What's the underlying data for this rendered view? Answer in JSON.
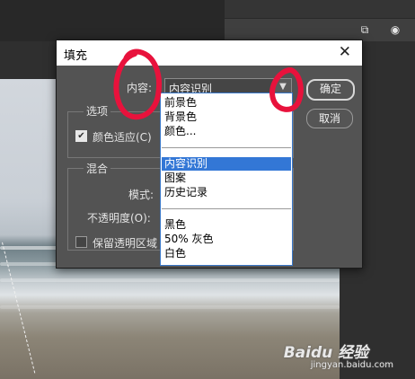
{
  "dialog": {
    "title": "填充",
    "content_label": "内容:",
    "content_value": "内容识别",
    "ok_label": "确定",
    "cancel_label": "取消",
    "options_group": "选项",
    "color_adapt_label": "颜色适应(C)",
    "blend_group": "混合",
    "mode_label": "模式:",
    "opacity_label": "不透明度(O):",
    "preserve_label": "保留透明区域"
  },
  "dropdown": {
    "group1": [
      "前景色",
      "背景色",
      "颜色..."
    ],
    "group2": [
      "内容识别",
      "图案",
      "历史记录"
    ],
    "group3": [
      "黑色",
      "50% 灰色",
      "白色"
    ],
    "selected": "内容识别"
  },
  "watermark": {
    "main": "Baidu 经验",
    "sub": "jingyan.baidu.com"
  },
  "colors": {
    "dialog_bg": "#535353",
    "selection": "#3377d6",
    "annotation": "#e8123c"
  },
  "icons": [
    "add-layer-icon",
    "camera-icon",
    "close-icon",
    "chevron-down-icon",
    "check-icon"
  ]
}
